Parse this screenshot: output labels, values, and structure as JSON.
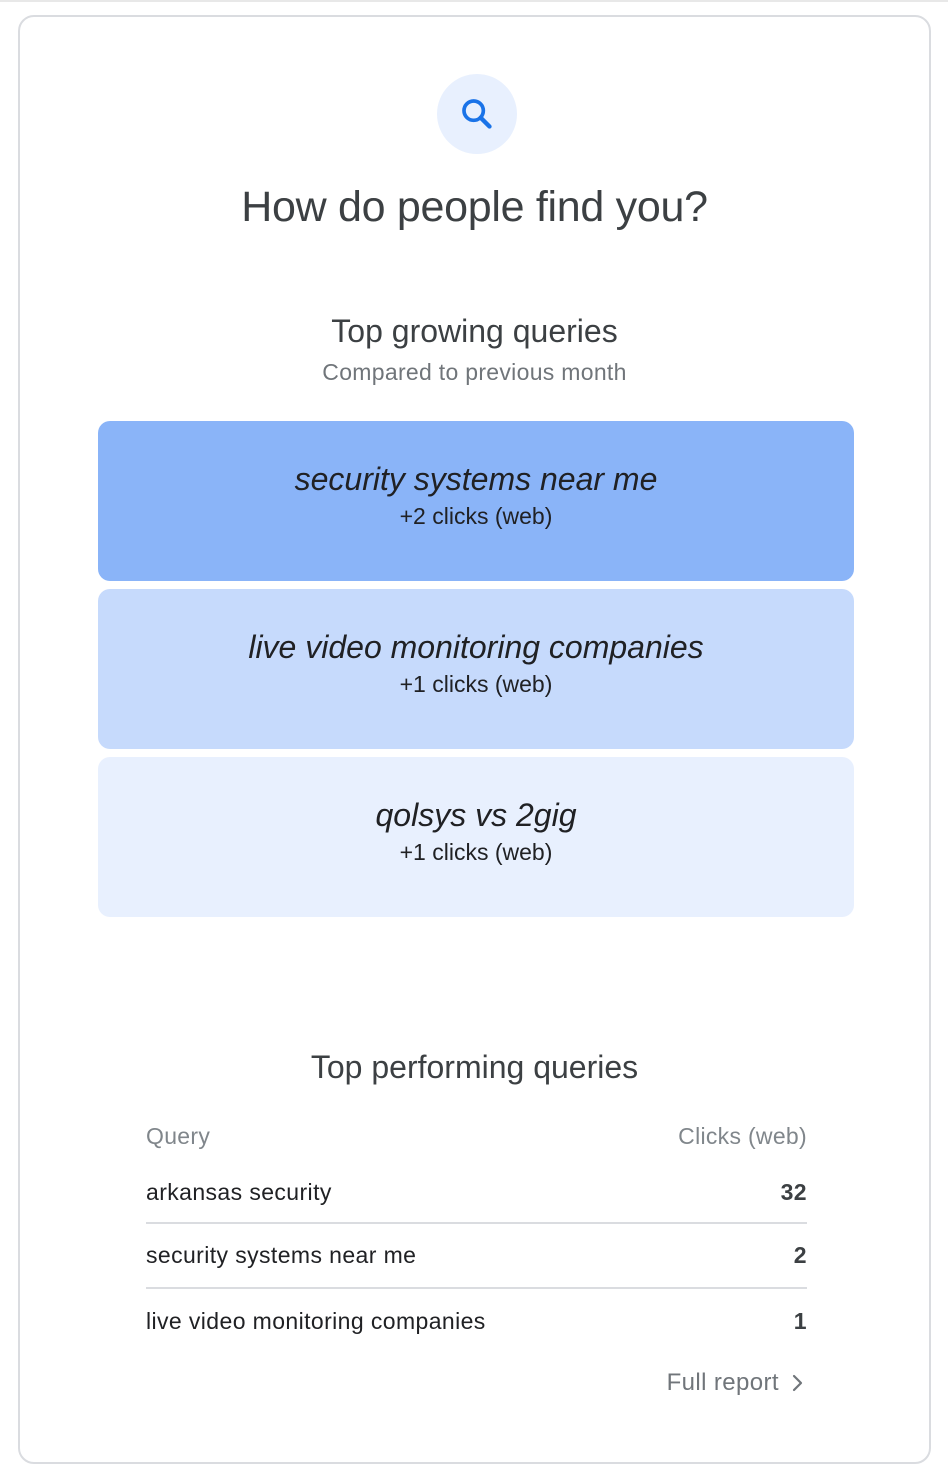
{
  "header": {
    "icon": "search-icon",
    "title": "How do people find you?"
  },
  "growing": {
    "title": "Top growing queries",
    "subtitle": "Compared to previous month",
    "items": [
      {
        "query": "security systems near me",
        "clicks": "+2 clicks (web)"
      },
      {
        "query": "live video monitoring companies",
        "clicks": "+1 clicks (web)"
      },
      {
        "query": "qolsys vs 2gig",
        "clicks": "+1 clicks (web)"
      }
    ]
  },
  "performing": {
    "title": "Top performing queries",
    "columns": {
      "query": "Query",
      "clicks": "Clicks (web)"
    },
    "rows": [
      {
        "query": "arkansas security",
        "clicks": "32"
      },
      {
        "query": "security systems near me",
        "clicks": "2"
      },
      {
        "query": "live video monitoring companies",
        "clicks": "1"
      }
    ]
  },
  "footer": {
    "full_report": "Full report",
    "icon": "chevron-right-icon"
  },
  "colors": {
    "accent": "#1a73e8",
    "box1": "#8ab4f8",
    "box2": "#c6dafc",
    "box3": "#e8f0fe"
  }
}
